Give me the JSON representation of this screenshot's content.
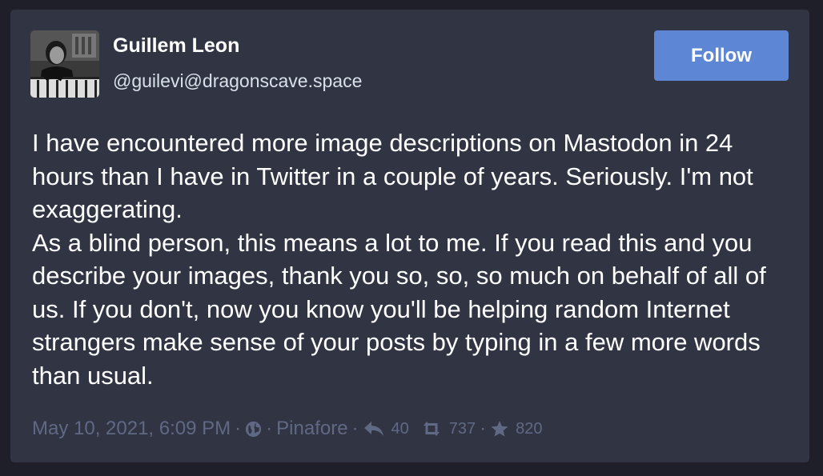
{
  "status": {
    "author": {
      "display_name": "Guillem Leon",
      "handle": "@guilevi@dragonscave.space"
    },
    "follow_label": "Follow",
    "content": {
      "paragraph_1": "I have encountered more image descriptions on Mastodon in 24 hours than I have in Twitter in a couple of years. Seriously. I'm not exaggerating.",
      "paragraph_2": "As a blind person, this means a lot to me. If you read this and you describe your images, thank you so, so, so much on behalf of all of us. If you don't, now you know you'll be helping random Internet strangers make sense of your posts by typing in a few more words than usual."
    },
    "meta": {
      "timestamp": "May 10, 2021, 6:09 PM",
      "separator": "·",
      "visibility_icon": "globe-icon",
      "application": "Pinafore",
      "replies_icon": "reply-icon",
      "replies_count": "40",
      "boosts_icon": "retweet-icon",
      "boosts_count": "737",
      "favourites_icon": "star-icon",
      "favourites_count": "820"
    }
  },
  "colors": {
    "page_background": "#1f1f29",
    "card_background": "#313443",
    "accent": "#5d87d4",
    "text_primary": "#ffffff",
    "text_secondary": "#d9e1e8",
    "text_muted": "#606984"
  }
}
